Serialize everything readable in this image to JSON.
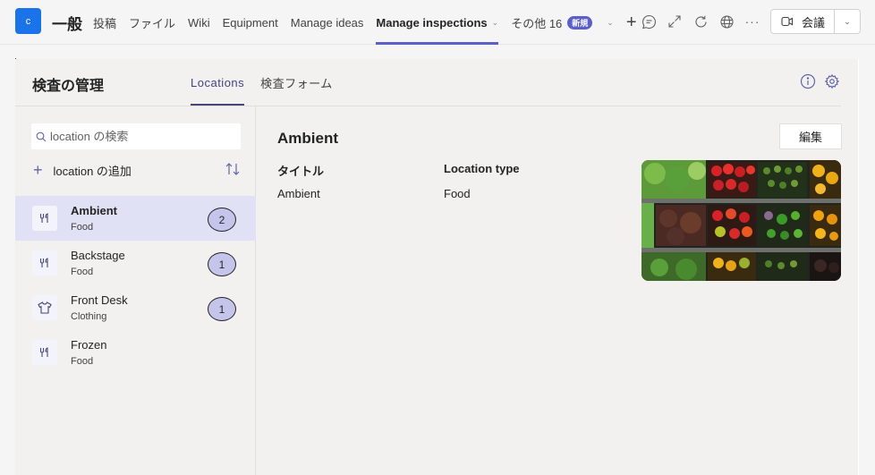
{
  "header": {
    "app_initial": "c",
    "team_name": "一般",
    "tabs": [
      {
        "label": "投稿",
        "active": false
      },
      {
        "label": "ファイル",
        "active": false
      },
      {
        "label": "Wiki",
        "active": false
      },
      {
        "label": "Equipment",
        "active": false
      },
      {
        "label": "Manage ideas",
        "active": false
      },
      {
        "label": "Manage inspections",
        "active": true
      }
    ],
    "more_label": "その他 16",
    "new_badge": "新規",
    "add_tab_icon": "plus-icon",
    "icons": [
      "chat-icon",
      "expand-icon",
      "refresh-icon",
      "globe-icon",
      "more-icon"
    ],
    "meeting_label": "会議"
  },
  "app": {
    "title": "検査の管理",
    "tabs": [
      {
        "label": "Locations",
        "active": true
      },
      {
        "label": "検査フォーム",
        "active": false
      }
    ],
    "accent_color": "#6264a7"
  },
  "left_panel": {
    "search_placeholder": "location の検索",
    "add_label": "location の追加",
    "locations": [
      {
        "name": "Ambient",
        "type": "Food",
        "icon": "utensils-icon",
        "count": "2",
        "selected": true
      },
      {
        "name": "Backstage",
        "type": "Food",
        "icon": "utensils-icon",
        "count": "1",
        "selected": false
      },
      {
        "name": "Front Desk",
        "type": "Clothing",
        "icon": "shirt-icon",
        "count": "1",
        "selected": false
      },
      {
        "name": "Frozen",
        "type": "Food",
        "icon": "utensils-icon",
        "count": null,
        "selected": false
      }
    ]
  },
  "detail": {
    "title": "Ambient",
    "edit_label": "編集",
    "fields": [
      {
        "label": "タイトル",
        "value": "Ambient"
      },
      {
        "label": "Location type",
        "value": "Food"
      }
    ],
    "image_alt": "produce shelves"
  }
}
